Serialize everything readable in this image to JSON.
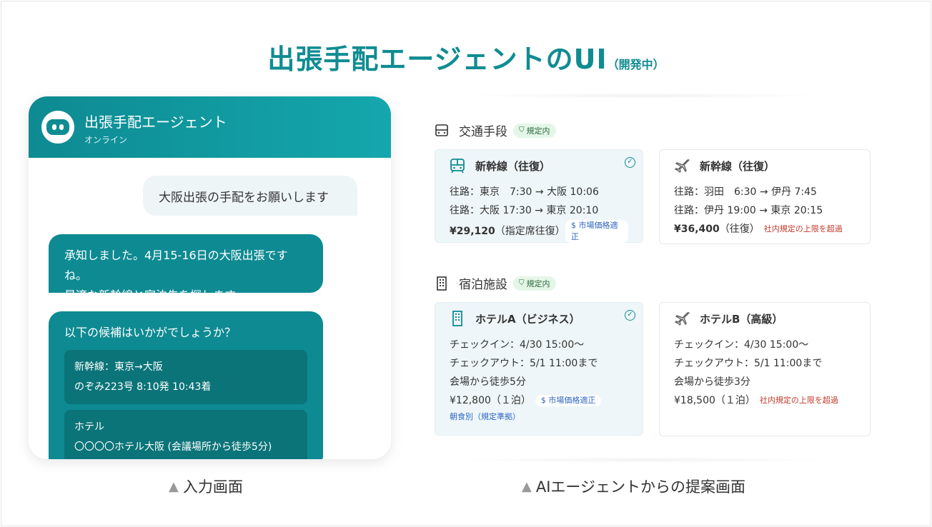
{
  "page": {
    "title": "出張手配エージェントのUI",
    "title_sub": "（開発中）",
    "accent_color": "#0f8c92"
  },
  "chat": {
    "header_title": "出張手配エージェント",
    "header_status": "オンライン",
    "avatar_icon": "robot-icon",
    "user_message": "大阪出張の手配をお願いします",
    "bot_message_1_line1": "承知しました。4月15-16日の大阪出張ですね。",
    "bot_message_1_line2": "最適な新幹線と宿泊先を探します。",
    "bot_message_2_title": "以下の候補はいかがでしょうか？",
    "option_1_line1": "新幹線：東京→大阪",
    "option_1_line2": "のぞみ223号 8:10発 10:43着",
    "option_2_line1": "ホテル",
    "option_2_line2": "〇〇〇〇ホテル大阪 (会議場所から徒歩5分)"
  },
  "transport": {
    "section_label": "交通手段",
    "section_icon": "train-icon",
    "badge": "規定内",
    "recommended": {
      "title": "新幹線（往復）",
      "icon": "train-icon",
      "line1": "往路：東京　7:30 → 大阪 10:06",
      "line2": "往路：大阪 17:30 → 東京 20:10",
      "price": "¥29,120",
      "price_note": "（指定席往復）",
      "tag": "$ 市場価格適正"
    },
    "alternative": {
      "title": "新幹線（往復）",
      "icon": "airplane-icon",
      "line1": "往路：羽田　6:30 → 伊丹 7:45",
      "line2": "往路：伊丹 19:00 → 東京 20:15",
      "price": "¥36,400",
      "price_note": "（往復）",
      "tag": "社内規定の上限を超過"
    }
  },
  "lodging": {
    "section_label": "宿泊施設",
    "section_icon": "building-icon",
    "badge": "規定内",
    "recommended": {
      "title": "ホテルA（ビジネス）",
      "icon": "building-icon",
      "line1": "チェックイン：4/30  15:00〜",
      "line2": "チェックアウト：5/1  11:00まで",
      "line3": "会場から徒歩5分",
      "price": "¥12,800（１泊）",
      "tag": "$ 市場価格適正",
      "note": "朝食別（規定準拠）"
    },
    "alternative": {
      "title": "ホテルB（高級）",
      "icon": "airplane-icon",
      "line1": "チェックイン：4/30  15:00〜",
      "line2": "チェックアウト：5/1  11:00まで",
      "line3": "会場から徒歩3分",
      "price": "¥18,500（１泊）",
      "tag": "社内規定の上限を超過"
    }
  },
  "captions": {
    "left": "入力画面",
    "right": "AIエージェントからの提案画面"
  }
}
